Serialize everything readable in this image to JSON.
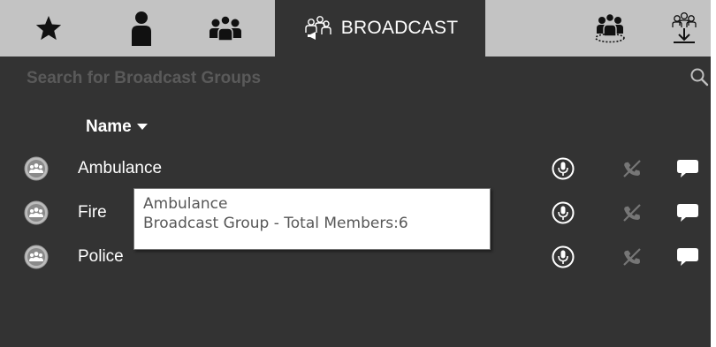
{
  "tabs": [
    {
      "id": "favorites",
      "icon": "star-icon",
      "label": ""
    },
    {
      "id": "contacts",
      "icon": "person-icon",
      "label": ""
    },
    {
      "id": "groups",
      "icon": "group-icon",
      "label": ""
    },
    {
      "id": "broadcast",
      "icon": "broadcast-group-icon",
      "label": "BROADCAST",
      "active": true
    },
    {
      "id": "dynamic-groups",
      "icon": "dynamic-group-icon",
      "label": ""
    },
    {
      "id": "download-groups",
      "icon": "download-group-icon",
      "label": ""
    }
  ],
  "search": {
    "placeholder": "Search for Broadcast Groups",
    "value": ""
  },
  "list": {
    "column_header": "Name",
    "sort": "descending",
    "rows": [
      {
        "name": "Ambulance"
      },
      {
        "name": "Fire"
      },
      {
        "name": "Police"
      }
    ]
  },
  "tooltip": {
    "title": "Ambulance",
    "detail": "Broadcast Group - Total Members:6"
  },
  "colors": {
    "panel": "#333333",
    "tabbar": "#c3c3c3",
    "text": "#ffffff",
    "muted_icon": "#767676"
  }
}
